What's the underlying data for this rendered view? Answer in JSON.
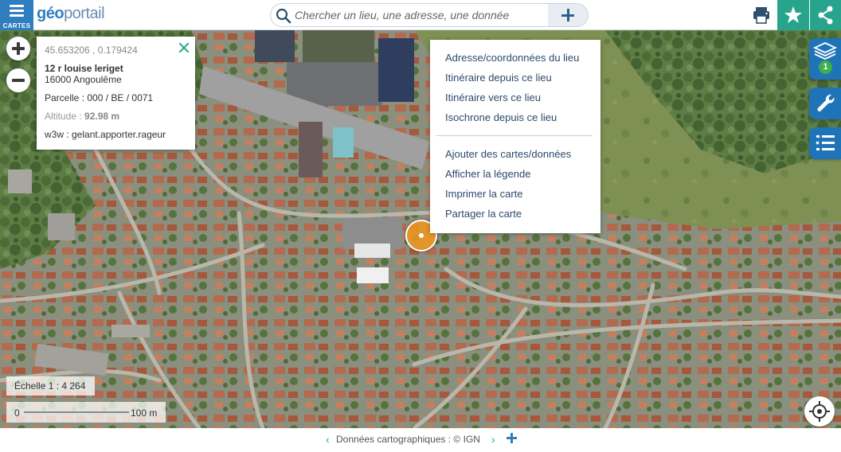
{
  "header": {
    "menu_label": "CARTES",
    "logo_part1": "géo",
    "logo_part2": "portail",
    "search_placeholder": "Chercher un lieu, une adresse, une donnée"
  },
  "icons": {
    "menu": "hamburger-icon",
    "search": "search-icon",
    "add": "plus-icon",
    "print": "printer-icon",
    "favorite": "star-icon",
    "share": "share-icon",
    "layers": "layers-icon",
    "tools": "wrench-icon",
    "legend": "legend-list-icon",
    "locate": "crosshair-icon",
    "close": "close-icon"
  },
  "info_popup": {
    "coordinates": "45.653206 , 0.179424",
    "address": "12 r louise leriget",
    "city": "16000 Angoulême",
    "parcel": "Parcelle : 000 / BE / 0071",
    "altitude_label": "Altitude :",
    "altitude_value": "92.98 m",
    "w3w": "w3w : gelant.apporter.rageur"
  },
  "context_menu": {
    "items": [
      "Adresse/coordonnées du lieu",
      "Itinéraire depuis ce lieu",
      "Itinéraire vers ce lieu",
      "Isochrone depuis ce lieu",
      "Ajouter des cartes/données",
      "Afficher la légende",
      "Imprimer la carte",
      "Partager la carte"
    ]
  },
  "layers": {
    "count": "1"
  },
  "scale": {
    "ratio": "Échelle 1 : 4 264",
    "zero": "0",
    "distance": "100 m"
  },
  "footer": {
    "attribution": "Données cartographiques : © IGN"
  },
  "colors": {
    "primary_blue": "#2f7ec0",
    "accent_green": "#28a48d",
    "marker_orange": "#f0961e",
    "layer_badge_green": "#3cb04a"
  }
}
